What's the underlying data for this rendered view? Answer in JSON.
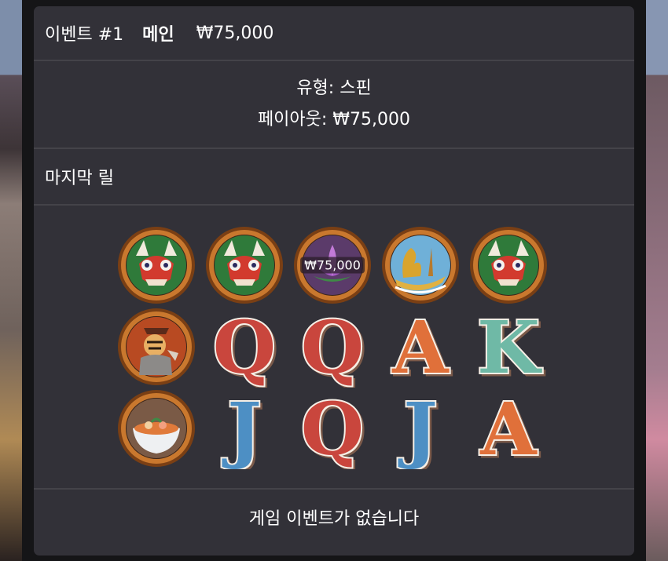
{
  "header": {
    "event_label": "이벤트 #1",
    "type_label": "메인",
    "amount": "₩75,000"
  },
  "info": {
    "type_line": "유형: 스핀",
    "payout_line": "페이아웃: ₩75,000"
  },
  "last_reel": {
    "title": "마지막 릴"
  },
  "reels": {
    "rows": [
      [
        {
          "symbol": "dragon-mask-icon",
          "win": ""
        },
        {
          "symbol": "dragon-mask-icon",
          "win": ""
        },
        {
          "symbol": "lotus-icon",
          "win": "₩75,000"
        },
        {
          "symbol": "golden-dragon-boat-icon",
          "win": ""
        },
        {
          "symbol": "dragon-mask-icon",
          "win": ""
        }
      ],
      [
        {
          "symbol": "tiger-warrior-icon",
          "win": ""
        },
        {
          "symbol": "letter-q-icon",
          "win": ""
        },
        {
          "symbol": "letter-q-icon",
          "win": ""
        },
        {
          "symbol": "letter-a-icon",
          "win": ""
        },
        {
          "symbol": "letter-k-icon",
          "win": ""
        }
      ],
      [
        {
          "symbol": "noodle-bowl-icon",
          "win": ""
        },
        {
          "symbol": "letter-j-icon",
          "win": ""
        },
        {
          "symbol": "letter-q-icon",
          "win": ""
        },
        {
          "symbol": "letter-j-icon",
          "win": ""
        },
        {
          "symbol": "letter-a-icon",
          "win": ""
        }
      ]
    ],
    "letters": {
      "letter-q-icon": "Q",
      "letter-a-icon": "A",
      "letter-k-icon": "K",
      "letter-j-icon": "J"
    },
    "colors": {
      "letter-q-icon": "#c9463d",
      "letter-a-icon": "#e0703a",
      "letter-k-icon": "#6fb9a6",
      "letter-j-icon": "#4d8fc4",
      "ring": "#c9782e"
    }
  },
  "footer": {
    "message": "게임 이벤트가 없습니다"
  }
}
